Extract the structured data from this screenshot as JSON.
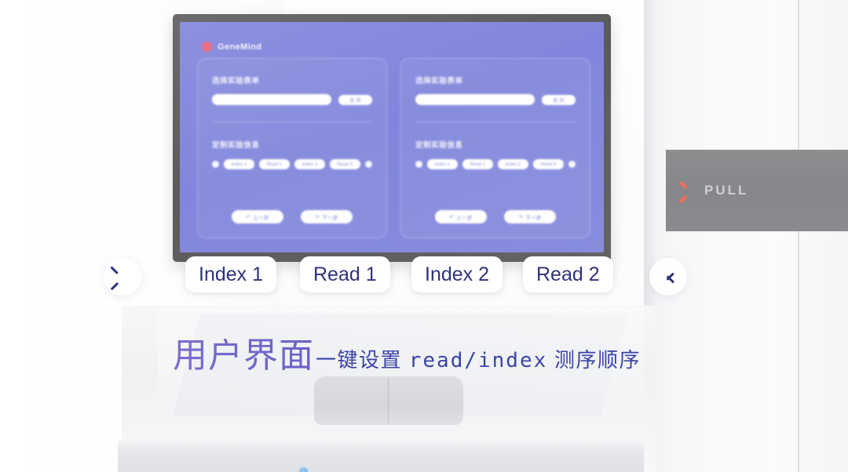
{
  "scene": {
    "machine_panel": {
      "label": "PULL",
      "chevron_icon": "chevron-left-icon",
      "panel_color": "#8a8b8e",
      "chevron_color": "#e4725f",
      "label_color": "#cfd0d1"
    }
  },
  "monitor": {
    "bezel_color": "#5a5a5b",
    "screen_bg_color": "#8186dc",
    "brand": {
      "name": "GeneMind",
      "mark_icon": "hexagon-logo-icon",
      "mark_color": "#ef6f84"
    },
    "panels": [
      {
        "select_label": "选择实验表单",
        "input_value": "",
        "input_placeholder": "",
        "select_button_label": "选 择",
        "config_label": "定制实验信息",
        "chips": [
          "Index 1",
          "Read 1",
          "Index 2",
          "Read 2"
        ],
        "prev_button": "上一步",
        "next_button": "下一步",
        "prev_icon": "undo-arrow-icon",
        "next_icon": "redo-arrow-icon"
      },
      {
        "select_label": "选择实验表单",
        "input_value": "",
        "input_placeholder": "",
        "select_button_label": "选 择",
        "config_label": "定制实验信息",
        "chips": [
          "Index 1",
          "Read 1",
          "Index 2",
          "Read 2"
        ],
        "prev_button": "上一步",
        "next_button": "下一步",
        "prev_icon": "undo-arrow-icon",
        "next_icon": "redo-arrow-icon"
      }
    ]
  },
  "sequence_selector": {
    "prev_icon": "chevron-left-icon",
    "next_icon": "chevron-right-icon",
    "pill_text_color": "#2e3479",
    "steps": [
      {
        "label": "Index 1"
      },
      {
        "label": "Read 1"
      },
      {
        "label": "Index 2"
      },
      {
        "label": "Read 2"
      }
    ]
  },
  "caption": {
    "headline": "用户界面",
    "headline_color": "#6b5fc4",
    "subline_pre": "一键设置 ",
    "subline_mono": "read/index",
    "subline_post": " 测序顺序",
    "subline_color": "#3a44a8"
  }
}
